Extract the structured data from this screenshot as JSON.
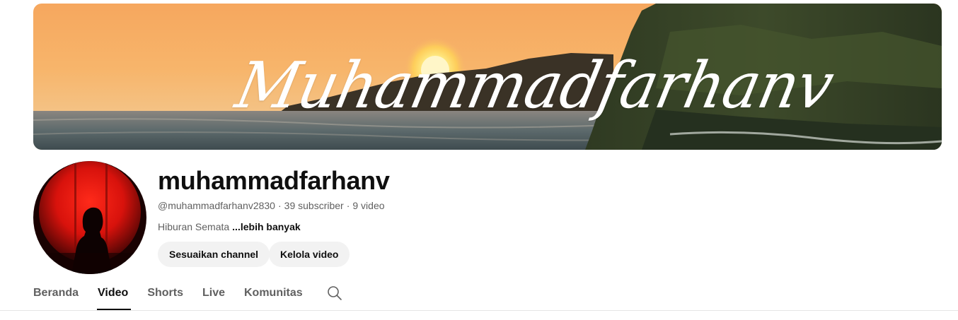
{
  "banner": {
    "title": "Muhammadfarhanv"
  },
  "channel": {
    "name": "muhammadfarhanv",
    "handle": "@muhammadfarhanv2830",
    "subscribers": "39 subscriber",
    "videos": "9 video",
    "separator": "·",
    "description": "Hiburan Semata",
    "more_label": "...lebih banyak"
  },
  "actions": {
    "customize_label": "Sesuaikan channel",
    "manage_label": "Kelola video"
  },
  "tabs": [
    {
      "label": "Beranda",
      "active": false
    },
    {
      "label": "Video",
      "active": true
    },
    {
      "label": "Shorts",
      "active": false
    },
    {
      "label": "Live",
      "active": false
    },
    {
      "label": "Komunitas",
      "active": false
    }
  ],
  "icons": {
    "tab_search": "search-icon"
  },
  "colors": {
    "text_primary": "#0f0f0f",
    "text_secondary": "#606060",
    "button_bg": "#f2f2f2",
    "divider": "#e5e5e5"
  }
}
